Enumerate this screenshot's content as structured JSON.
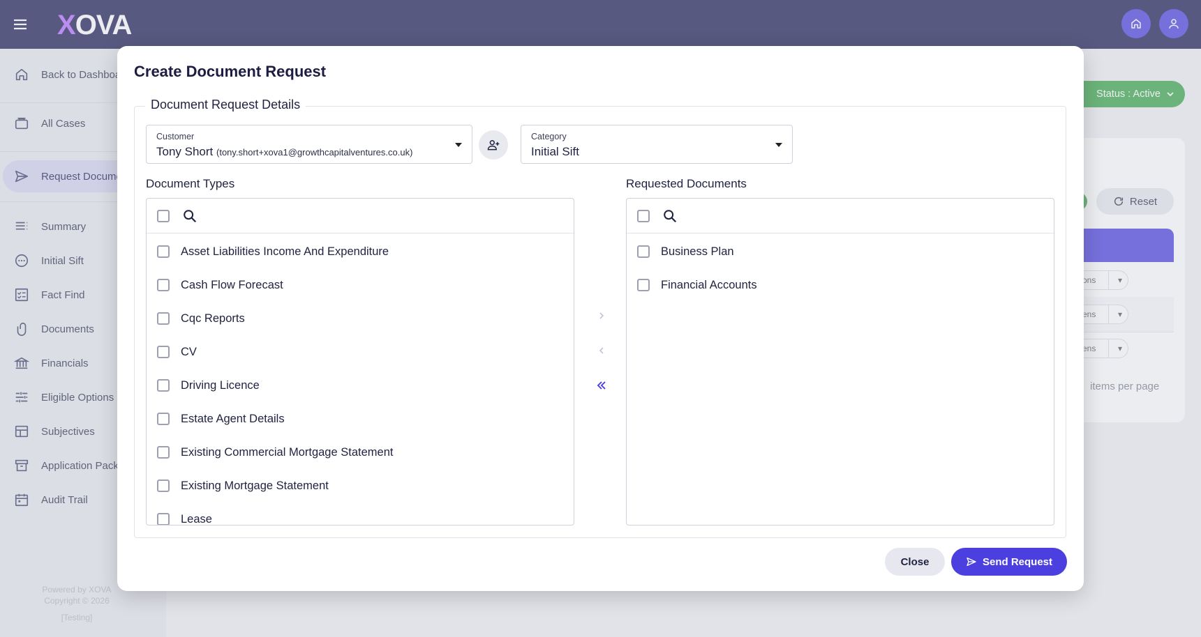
{
  "app": {
    "logo": "XOVA"
  },
  "sidebar": {
    "items": [
      {
        "label": "Back to Dashboard",
        "icon": "home-icon"
      },
      {
        "label": "All Cases",
        "icon": "briefcase-icon"
      },
      {
        "label": "Request Documents",
        "icon": "send-icon"
      },
      {
        "label": "Summary",
        "icon": "list-icon"
      },
      {
        "label": "Initial Sift",
        "icon": "more-circle-icon"
      },
      {
        "label": "Fact Find",
        "icon": "checklist-icon"
      },
      {
        "label": "Documents",
        "icon": "paperclip-icon"
      },
      {
        "label": "Financials",
        "icon": "bank-icon"
      },
      {
        "label": "Eligible Options",
        "icon": "sliders-icon"
      },
      {
        "label": "Subjectives",
        "icon": "table-icon"
      },
      {
        "label": "Application Pack",
        "icon": "archive-icon"
      },
      {
        "label": "Audit Trail",
        "icon": "calendar-icon"
      }
    ],
    "footer": {
      "powered": "Powered by XOVA",
      "copyright": "Copyright © 2026",
      "env": "[Testing]"
    }
  },
  "background": {
    "status_label": "Status : Active",
    "reset_label": "Reset",
    "row_actions": [
      "ons",
      "ens",
      "ens"
    ],
    "items_per_page": "items per page"
  },
  "modal": {
    "title": "Create Document Request",
    "section_title": "Document Request Details",
    "customer": {
      "label": "Customer",
      "name": "Tony Short",
      "email": "(tony.short+xova1@growthcapitalventures.co.uk)"
    },
    "category": {
      "label": "Category",
      "value": "Initial Sift"
    },
    "document_types": {
      "title": "Document Types",
      "items": [
        "Asset Liabilities Income And Expenditure",
        "Cash Flow Forecast",
        "Cqc Reports",
        "CV",
        "Driving Licence",
        "Estate Agent Details",
        "Existing Commercial Mortgage Statement",
        "Existing Mortgage Statement",
        "Lease"
      ]
    },
    "requested_documents": {
      "title": "Requested Documents",
      "items": [
        "Business Plan",
        "Financial Accounts"
      ]
    },
    "buttons": {
      "close": "Close",
      "send": "Send Request"
    }
  },
  "colors": {
    "topbar": "#1c1d54",
    "primary": "#4b3fe0",
    "success": "#3aa64a",
    "active_nav": "#d4d3f0"
  }
}
